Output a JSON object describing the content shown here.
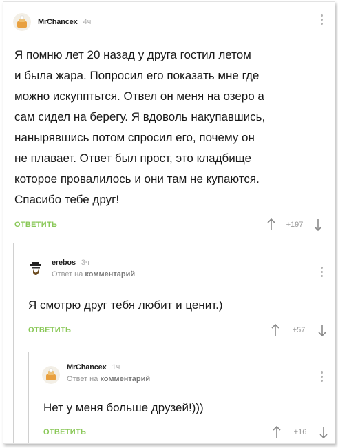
{
  "comments": [
    {
      "author": "MrChancex",
      "time": "4ч",
      "text_lines": [
        "Я помню лет 20 назад у друга гостил летом",
        "и была жара. Попросил его показать мне где",
        "можно искупптьтся. Отвел он меня на озеро а",
        "сам сидел на берегу. Я вдоволь накупавшись,",
        "нанырявшись потом спросил его, почему он",
        "не плавает. Ответ был прост, это кладбище",
        "которое провалилось и они там не купаются.",
        "Спасибо тебе друг!"
      ],
      "reply_label": "ОТВЕТИТЬ",
      "rating": "+197",
      "avatar_icon": "chancex-avatar"
    },
    {
      "author": "erebos",
      "time": "3ч",
      "reply_to_prefix": "Ответ на",
      "reply_to_link": "комментарий",
      "text_lines": [
        "Я смотрю друг тебя любит и ценит.)"
      ],
      "reply_label": "ОТВЕТИТЬ",
      "rating": "+57",
      "avatar_icon": "heisenberg-avatar"
    },
    {
      "author": "MrChancex",
      "time": "1ч",
      "reply_to_prefix": "Ответ на",
      "reply_to_link": "комментарий",
      "text_lines": [
        "Нет у меня больше друзей!)))"
      ],
      "reply_label": "ОТВЕТИТЬ",
      "rating": "+16",
      "avatar_icon": "chancex-avatar"
    }
  ],
  "colors": {
    "accent_green": "#8ac858",
    "muted_text": "#9a9a9a",
    "thread_line": "#d0d0d0"
  }
}
